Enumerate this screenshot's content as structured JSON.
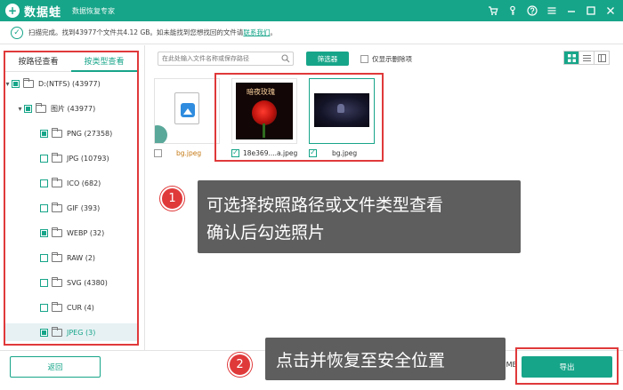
{
  "app": {
    "name": "数据蛙",
    "subtitle": "数据恢复专家"
  },
  "titlebar_icons": [
    "cart-icon",
    "key-icon",
    "help-icon",
    "minimize-icon",
    "maximize-icon",
    "close-icon"
  ],
  "status": {
    "text": "扫描完成。找到43977个文件共4.12 GB。如未能找到您想找回的文件请",
    "link": "联系我们",
    "suffix": "。"
  },
  "tabs": [
    {
      "label": "按路径查看",
      "active": false
    },
    {
      "label": "按类型查看",
      "active": true
    }
  ],
  "tree": {
    "drive": {
      "label": "D:(NTFS) (43977)",
      "checked": true,
      "expanded": true
    },
    "images": {
      "label": "图片 (43977)",
      "checked": true,
      "expanded": true
    },
    "types": [
      {
        "label": "PNG (27358)",
        "checked": true
      },
      {
        "label": "JPG (10793)",
        "checked": false
      },
      {
        "label": "ICO (682)",
        "checked": false
      },
      {
        "label": "GIF (393)",
        "checked": false
      },
      {
        "label": "WEBP (32)",
        "checked": true
      },
      {
        "label": "RAW (2)",
        "checked": false
      },
      {
        "label": "SVG (4380)",
        "checked": false
      },
      {
        "label": "CUR (4)",
        "checked": false
      },
      {
        "label": "JPEG (3)",
        "checked": true,
        "selected": true
      }
    ]
  },
  "toolbar": {
    "search_placeholder": "在此处输入文件名称或保存路径",
    "filter_label": "筛选器",
    "deleted_only_label": "仅显示删除项"
  },
  "files": [
    {
      "name": "bg.jpeg",
      "checked": false,
      "thumbnail": "image-file-icon"
    },
    {
      "name": "18e369....a.jpeg",
      "checked": true,
      "thumbnail": "rose-photo",
      "caption": "暗夜玫瑰"
    },
    {
      "name": "bg.jpeg",
      "checked": true,
      "thumbnail": "dark-wolf-photo"
    }
  ],
  "callouts": [
    {
      "number": "1",
      "lines": [
        "可选择按照路径或文件类型查看",
        "确认后勾选照片"
      ]
    },
    {
      "number": "2",
      "lines": [
        "点击并恢复至安全位置"
      ]
    }
  ],
  "bottom": {
    "back_label": "返回",
    "size_text": "1 MB",
    "export_label": "导出"
  },
  "colors": {
    "accent": "#17a589",
    "highlight": "#e0393a",
    "callout_bg": "#5e5e5e"
  }
}
